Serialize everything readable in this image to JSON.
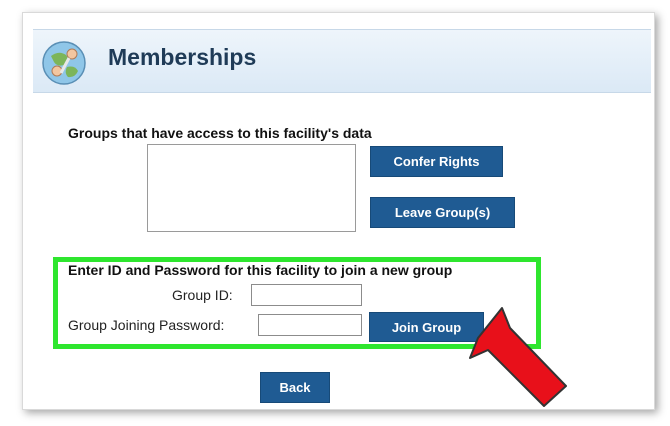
{
  "header": {
    "title": "Memberships",
    "icon": "memberships-globe-icon"
  },
  "groups_section": {
    "label": "Groups that have access to this facility's data",
    "confer_rights_label": "Confer Rights",
    "leave_groups_label": "Leave Group(s)"
  },
  "join_section": {
    "instruction": "Enter ID and Password for this facility to join a new group",
    "group_id_label": "Group ID:",
    "group_id_value": "",
    "password_label": "Group Joining Password:",
    "password_value": "",
    "join_label": "Join Group"
  },
  "back_label": "Back",
  "colors": {
    "button": "#1f5b93",
    "highlight_box": "#2ee62e",
    "arrow": "#e8101a",
    "header_bg": "#dbe9f6"
  }
}
